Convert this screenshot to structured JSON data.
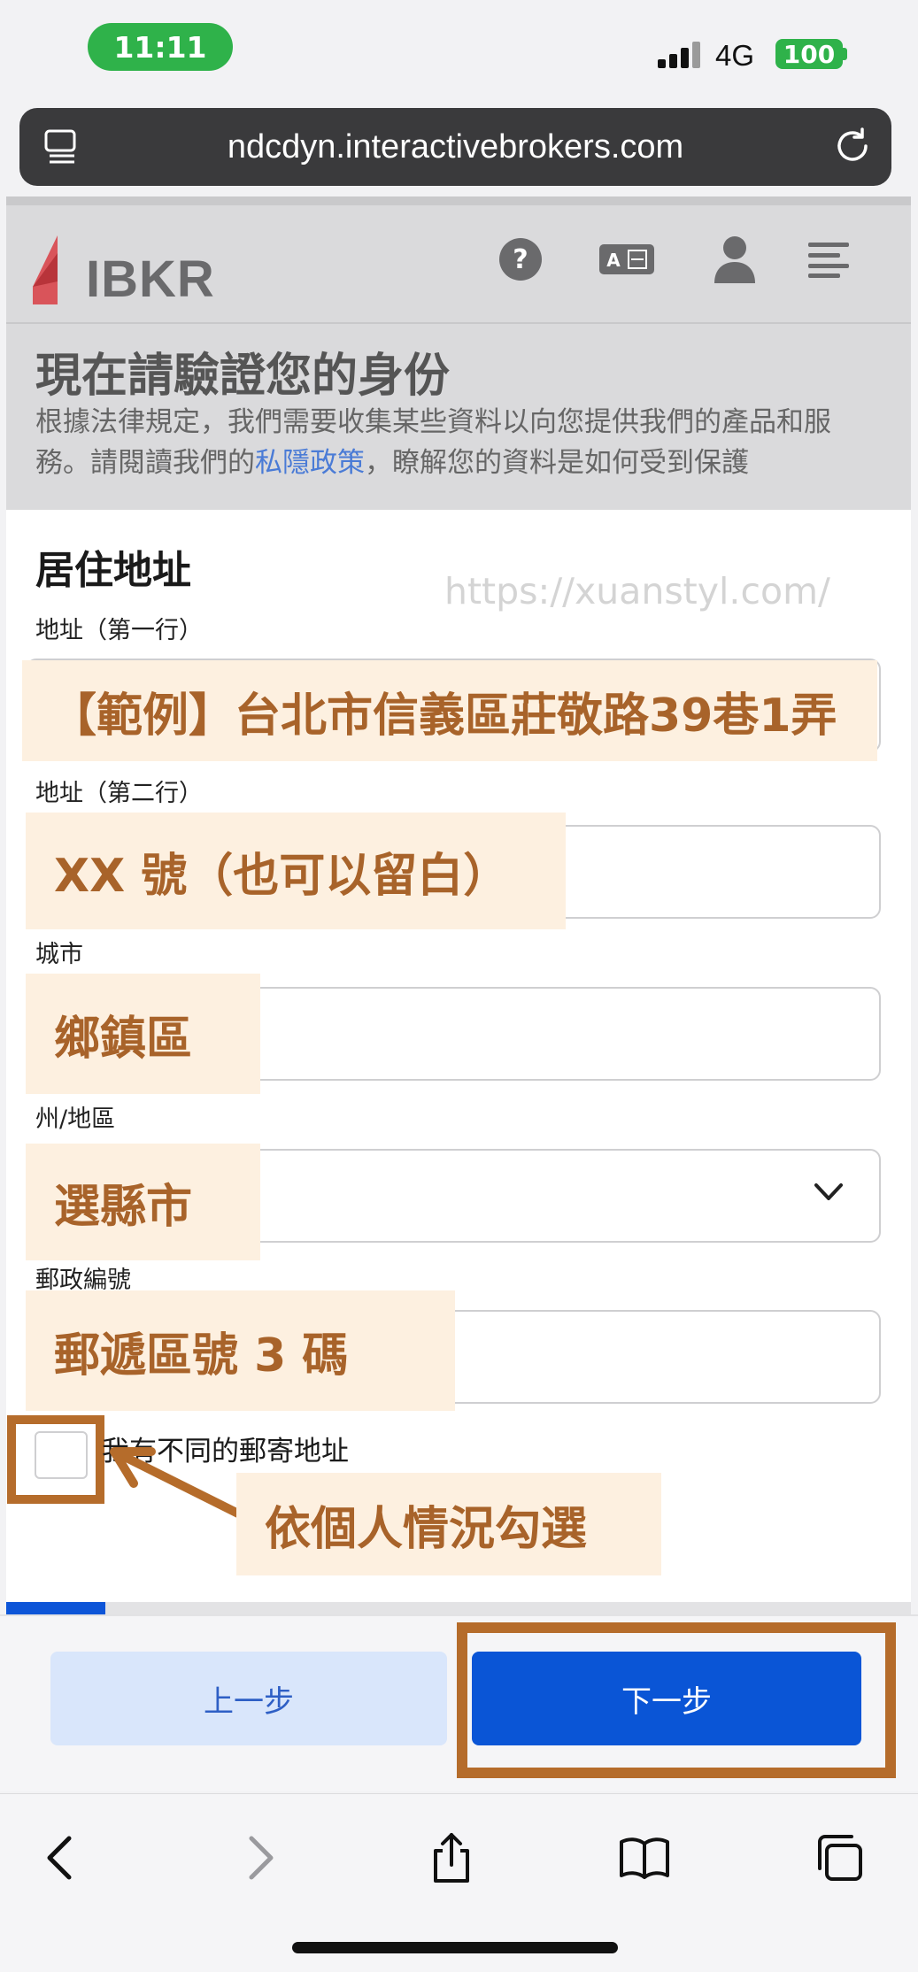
{
  "status_bar": {
    "time": "11:11",
    "network": "4G",
    "battery": "100"
  },
  "browser": {
    "url": "ndcdyn.interactivebrokers.com"
  },
  "site_header": {
    "logo_text": "IBKR",
    "icons": [
      "help-icon",
      "language-icon",
      "user-icon",
      "menu-icon"
    ]
  },
  "intro": {
    "title": "現在請驗證您的身份",
    "desc_before": "根據法律規定，我們需要收集某些資料以向您提供我們的產品和服務。請閱讀我們的",
    "privacy_link": "私隱政策",
    "desc_after": "，瞭解您的資料是如何受到保護"
  },
  "form": {
    "section_title": "居住地址",
    "fields": {
      "address_line1": {
        "label": "地址（第一行）",
        "value": ""
      },
      "address_line2": {
        "label": "地址（第二行）",
        "value": ""
      },
      "city": {
        "label": "城市",
        "value": ""
      },
      "state": {
        "label": "州/地區",
        "value": ""
      },
      "postal": {
        "label": "郵政編號",
        "value": ""
      }
    },
    "different_mailing_label": "我有不同的郵寄地址",
    "different_mailing_checked": false
  },
  "annotations": {
    "watermark": "https://xuanstyl.com/",
    "line1_note": "【範例】台北市信義區莊敬路39巷1弄",
    "line2_note": "XX 號（也可以留白）",
    "city_note": "鄉鎮區",
    "state_note": "選縣市",
    "postal_note": "郵遞區號 3 碼",
    "checkbox_note": "依個人情況勾選",
    "highlight_color": "#b56c2b"
  },
  "progress": {
    "fraction": 0.11
  },
  "actions": {
    "back_label": "上一步",
    "next_label": "下一步"
  },
  "safari_toolbar": [
    "back-icon",
    "forward-icon",
    "share-icon",
    "bookmarks-icon",
    "tabs-icon"
  ]
}
